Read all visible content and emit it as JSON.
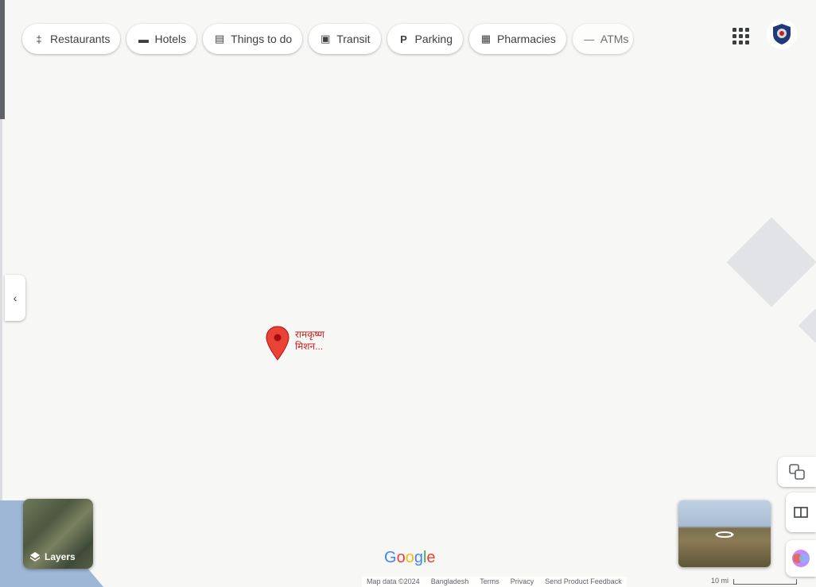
{
  "categories": [
    {
      "label": "Restaurants",
      "icon": "restaurant-icon",
      "glyph": "‡"
    },
    {
      "label": "Hotels",
      "icon": "hotel-icon",
      "glyph": "▬"
    },
    {
      "label": "Things to do",
      "icon": "ticket-icon",
      "glyph": "▤"
    },
    {
      "label": "Transit",
      "icon": "transit-icon",
      "glyph": "▣"
    },
    {
      "label": "Parking",
      "icon": "parking-icon",
      "glyph": "P"
    },
    {
      "label": "Pharmacies",
      "icon": "pharmacy-icon",
      "glyph": "▦"
    },
    {
      "label": "ATMs",
      "icon": "atm-icon",
      "glyph": "—"
    }
  ],
  "place_pin": {
    "label_line1": "रामकृष्ण",
    "label_line2": "मिशन..."
  },
  "layers": {
    "label": "Layers",
    "icon": "layers-icon"
  },
  "logo": {
    "letters": [
      "G",
      "o",
      "o",
      "g",
      "l",
      "e"
    ],
    "colors": [
      "#4285f4",
      "#ea4335",
      "#fbbc05",
      "#4285f4",
      "#34a853",
      "#ea4335"
    ]
  },
  "footer": {
    "map_data": "Map data ©2024",
    "country": "Bangladesh",
    "terms": "Terms",
    "privacy": "Privacy",
    "feedback": "Send Product Feedback",
    "scale": "10 mi"
  },
  "colors": {
    "pin": "#ea4335",
    "water": "#9fb7d6",
    "map_bg": "#f7f7f5"
  }
}
